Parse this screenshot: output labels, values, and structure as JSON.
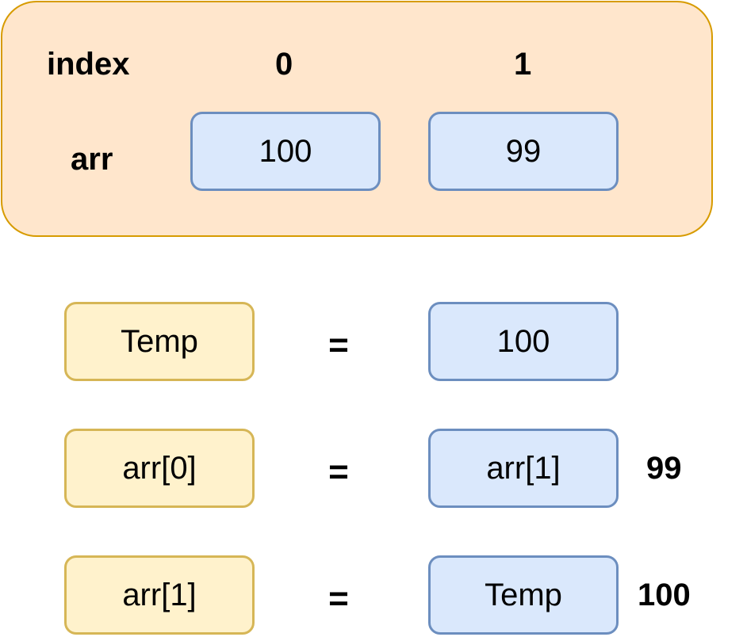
{
  "array_panel": {
    "index_label": "index",
    "arr_label": "arr",
    "indices": [
      "0",
      "1"
    ],
    "values": [
      "100",
      "99"
    ]
  },
  "swap_steps": [
    {
      "left": "Temp",
      "operator": "=",
      "right": "100",
      "result": ""
    },
    {
      "left": "arr[0]",
      "operator": "=",
      "right": "arr[1]",
      "result": "99"
    },
    {
      "left": "arr[1]",
      "operator": "=",
      "right": "Temp",
      "result": "100"
    }
  ],
  "colors": {
    "panel_fill": "#ffe6cc",
    "panel_stroke": "#d79b00",
    "blue_fill": "#dae8fc",
    "blue_stroke": "#6c8ebf",
    "yellow_fill": "#fff2cc",
    "yellow_stroke": "#d6b656"
  }
}
